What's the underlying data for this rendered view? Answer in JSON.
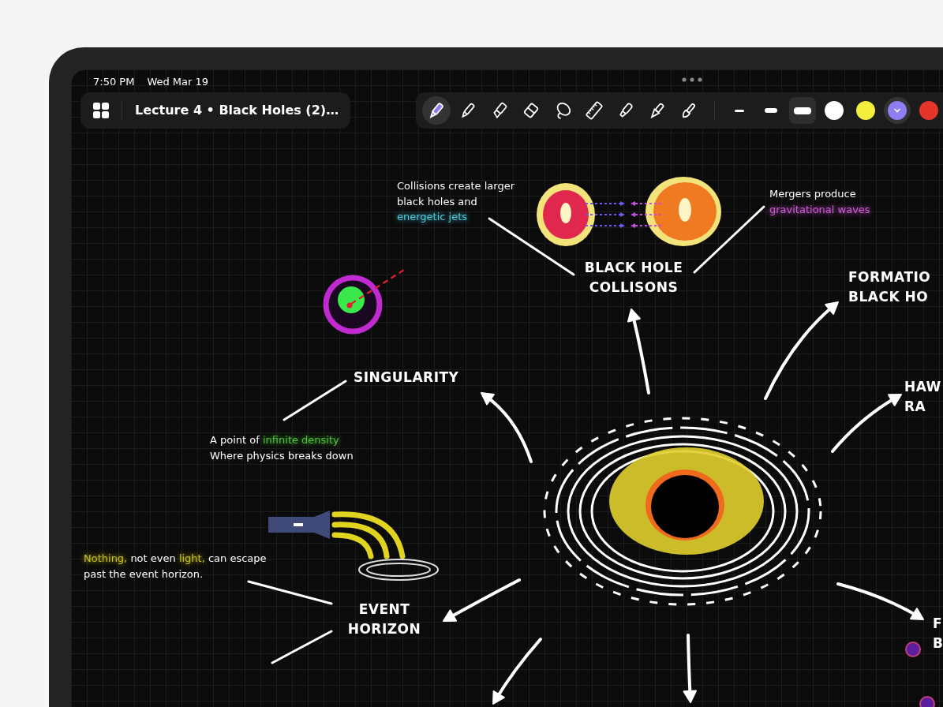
{
  "status_bar": {
    "time": "7:50 PM",
    "date": "Wed Mar 19"
  },
  "title_bar": {
    "title": "Lecture 4 • Black Holes (2)…"
  },
  "toolbar": {
    "tools": [
      {
        "kind": "pen",
        "selected": true
      },
      {
        "kind": "pencil",
        "selected": false
      },
      {
        "kind": "highlighter",
        "selected": false
      },
      {
        "kind": "eraser",
        "selected": false
      },
      {
        "kind": "lasso",
        "selected": false
      },
      {
        "kind": "ruler",
        "selected": false
      },
      {
        "kind": "marker",
        "selected": false
      },
      {
        "kind": "fountain",
        "selected": false
      },
      {
        "kind": "brush",
        "selected": false
      }
    ],
    "widths": [
      {
        "selected": false
      },
      {
        "selected": false
      },
      {
        "selected": true
      }
    ],
    "colors": [
      {
        "color": "#ffffff",
        "selected": false
      },
      {
        "color": "#f4ef3c",
        "selected": false
      },
      {
        "color": "#8d7ff2",
        "selected": true
      },
      {
        "color": "#e5352a",
        "selected": false
      }
    ]
  },
  "canvas": {
    "labels": [
      {
        "kind": "note",
        "lines": [
          [
            {
              "text": "Collisions create larger"
            }
          ],
          [
            {
              "text": "black holes and"
            }
          ],
          [
            {
              "text": "energetic jets",
              "color": "#4fc9dc"
            }
          ]
        ]
      },
      {
        "kind": "heading",
        "lines": [
          [
            {
              "text": "BLACK HOLE"
            }
          ],
          [
            {
              "text": "COLLISONS"
            }
          ]
        ]
      },
      {
        "kind": "note",
        "lines": [
          [
            {
              "text": "Mergers produce"
            }
          ],
          [
            {
              "text": "gravitational waves",
              "color": "#d05ad8"
            }
          ]
        ]
      },
      {
        "kind": "heading",
        "lines": [
          [
            {
              "text": "FORMATIO"
            }
          ],
          [
            {
              "text": "BLACK HO"
            }
          ]
        ]
      },
      {
        "kind": "heading",
        "lines": [
          [
            {
              "text": "SINGULARITY"
            }
          ]
        ]
      },
      {
        "kind": "note",
        "lines": [
          [
            {
              "text": "A point of "
            },
            {
              "text": "infinite density",
              "color": "#4fbf3c"
            }
          ],
          [
            {
              "text": "Where physics breaks down"
            }
          ]
        ]
      },
      {
        "kind": "heading",
        "lines": [
          [
            {
              "text": "HAW"
            }
          ],
          [
            {
              "text": "RA"
            }
          ]
        ]
      },
      {
        "kind": "note",
        "lines": [
          [
            {
              "text": "Nothing,",
              "color": "#c9c21e"
            },
            {
              "text": " not even "
            },
            {
              "text": "light,",
              "color": "#c9c21e"
            },
            {
              "text": " can escape"
            }
          ],
          [
            {
              "text": "past the event horizon."
            }
          ]
        ]
      },
      {
        "kind": "heading",
        "lines": [
          [
            {
              "text": "EVENT"
            }
          ],
          [
            {
              "text": "HORIZON"
            }
          ]
        ]
      },
      {
        "kind": "heading",
        "lines": [
          [
            {
              "text": "F"
            }
          ],
          [
            {
              "text": "B"
            }
          ]
        ]
      }
    ]
  }
}
